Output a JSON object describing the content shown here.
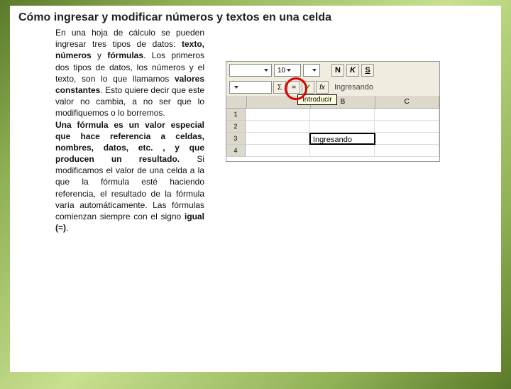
{
  "title": "Cómo ingresar y modificar números y textos en una celda",
  "para": {
    "s1": "En una hoja de cálculo se pueden ingresar tres tipos de datos: ",
    "b1": "texto, números",
    "s2": " y ",
    "b2": "fórmulas",
    "s3": ". Los primeros dos tipos de datos, los números y el texto, son lo que llamamos ",
    "b3": "valores constantes",
    "s4": ". Esto quiere decir que este valor no cambia, a no ser que lo modifiquemos o lo borremos.",
    "b4": "Una fórmula es un valor especial que hace referencia a celdas, nombres, datos, etc. , y que producen un resultado.",
    "s5": " Si modificamos el valor de una celda a la que la fórmula esté haciendo referencia, el resultado de la fórmula varía automáticamente. Las fórmulas comienzan siempre con el signo ",
    "b5": "igual (=)",
    "s6": "."
  },
  "shot": {
    "fontsize": "10",
    "N": "N",
    "K": "K",
    "S": "S",
    "funcSigma": "Σ",
    "funcEq": "=",
    "fx": "fx",
    "typing": "Ingresando",
    "tooltip": "Introducir",
    "colB": "B",
    "colC": "C",
    "r1": "1",
    "r2": "2",
    "r3": "3",
    "r4": "4",
    "cellval": "Ingresando"
  }
}
